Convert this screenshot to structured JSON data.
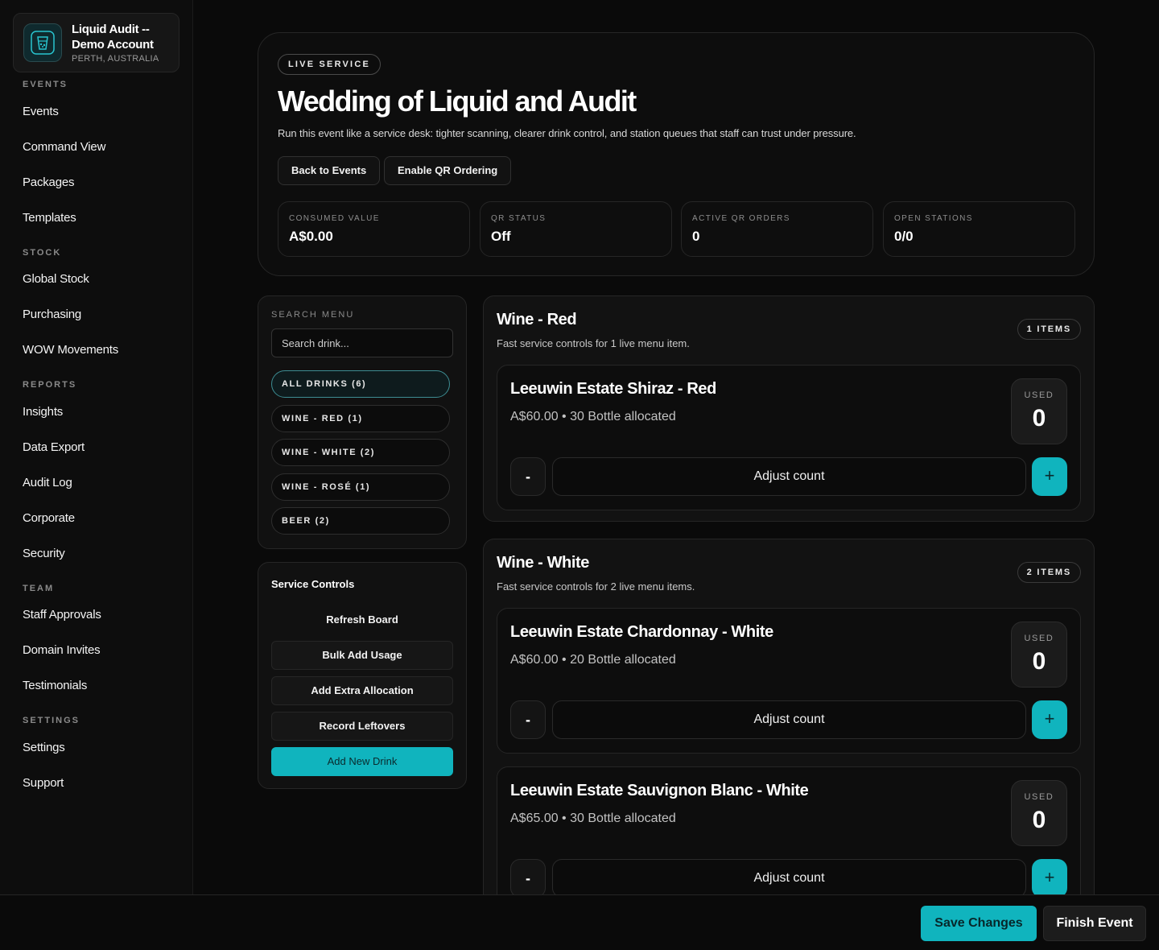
{
  "brand": {
    "name": "Liquid Audit -- Demo Account",
    "location": "PERTH, AUSTRALIA",
    "logo_icon": "cocktail-glass-icon"
  },
  "sidebar": {
    "sections": [
      {
        "label": "EVENTS",
        "items": [
          "Events",
          "Command View",
          "Packages",
          "Templates"
        ]
      },
      {
        "label": "STOCK",
        "items": [
          "Global Stock",
          "Purchasing",
          "WOW Movements"
        ]
      },
      {
        "label": "REPORTS",
        "items": [
          "Insights",
          "Data Export",
          "Audit Log",
          "Corporate",
          "Security"
        ]
      },
      {
        "label": "TEAM",
        "items": [
          "Staff Approvals",
          "Domain Invites",
          "Testimonials"
        ]
      },
      {
        "label": "SETTINGS",
        "items": [
          "Settings",
          "Support"
        ]
      }
    ]
  },
  "hero": {
    "badge": "LIVE SERVICE",
    "title": "Wedding of Liquid and Audit",
    "subtitle": "Run this event like a service desk: tighter scanning, clearer drink control, and station queues that staff can trust under pressure.",
    "back_label": "Back to Events",
    "qr_label": "Enable QR Ordering",
    "stats": [
      {
        "label": "CONSUMED VALUE",
        "value": "A$0.00"
      },
      {
        "label": "QR STATUS",
        "value": "Off"
      },
      {
        "label": "ACTIVE QR ORDERS",
        "value": "0"
      },
      {
        "label": "OPEN STATIONS",
        "value": "0/0"
      }
    ]
  },
  "search": {
    "label": "SEARCH MENU",
    "placeholder": "Search drink...",
    "filters": [
      "ALL DRINKS (6)",
      "WINE - RED (1)",
      "WINE - WHITE (2)",
      "WINE - ROSÉ (1)",
      "BEER (2)"
    ],
    "active_filter": "ALL DRINKS (6)"
  },
  "controls": {
    "title": "Service Controls",
    "refresh": "Refresh Board",
    "bulk": "Bulk Add Usage",
    "extra": "Add Extra Allocation",
    "leftovers": "Record Leftovers",
    "add_drink": "Add New Drink"
  },
  "categories": [
    {
      "title": "Wine - Red",
      "subtitle": "Fast service controls for 1 live menu item.",
      "count": "1 ITEMS",
      "items": [
        {
          "name": "Leeuwin Estate Shiraz - Red",
          "meta": "A$60.00 • 30 Bottle allocated",
          "used_label": "USED",
          "used": "0",
          "minus": "-",
          "adjust": "Adjust count",
          "plus": "+"
        }
      ]
    },
    {
      "title": "Wine - White",
      "subtitle": "Fast service controls for 2 live menu items.",
      "count": "2 ITEMS",
      "items": [
        {
          "name": "Leeuwin Estate Chardonnay - White",
          "meta": "A$60.00 • 20 Bottle allocated",
          "used_label": "USED",
          "used": "0",
          "minus": "-",
          "adjust": "Adjust count",
          "plus": "+"
        },
        {
          "name": "Leeuwin Estate Sauvignon Blanc - White",
          "meta": "A$65.00 • 30 Bottle allocated",
          "used_label": "USED",
          "used": "0",
          "minus": "-",
          "adjust": "Adjust count",
          "plus": "+"
        }
      ]
    }
  ],
  "footer": {
    "save": "Save Changes",
    "finish": "Finish Event"
  },
  "colors": {
    "accent": "#10b4be",
    "background": "#0a0a0a",
    "panel": "#121212"
  }
}
